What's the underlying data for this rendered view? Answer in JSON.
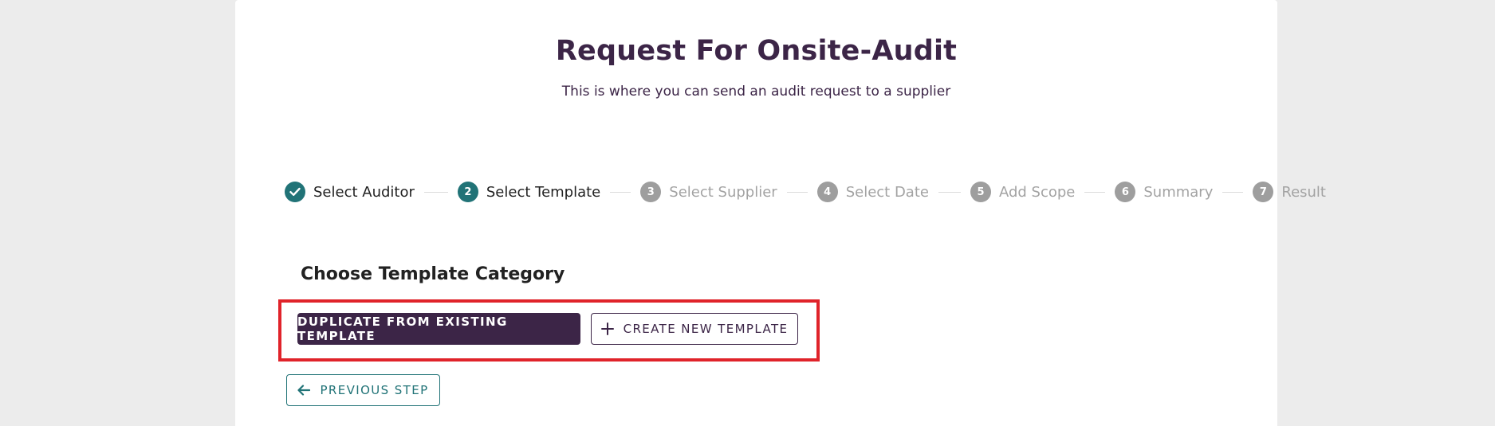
{
  "header": {
    "title": "Request For Onsite-Audit",
    "subtitle": "This is where you can send an audit request to a supplier"
  },
  "stepper": {
    "steps": [
      {
        "number": "1",
        "label": "Select Auditor",
        "state": "done"
      },
      {
        "number": "2",
        "label": "Select Template",
        "state": "active"
      },
      {
        "number": "3",
        "label": "Select Supplier",
        "state": "pending"
      },
      {
        "number": "4",
        "label": "Select Date",
        "state": "pending"
      },
      {
        "number": "5",
        "label": "Add Scope",
        "state": "pending"
      },
      {
        "number": "6",
        "label": "Summary",
        "state": "pending"
      },
      {
        "number": "7",
        "label": "Result",
        "state": "pending"
      }
    ],
    "icons": {
      "done": "check-icon"
    }
  },
  "main": {
    "section_title": "Choose Template Category",
    "duplicate_button": "DUPLICATE FROM EXISTING TEMPLATE",
    "create_button": "CREATE NEW TEMPLATE",
    "create_icon": "plus-icon",
    "previous_button": "PREVIOUS STEP",
    "previous_icon": "arrow-left-icon"
  },
  "colors": {
    "primary": "#3c2547",
    "accent": "#217377",
    "inactive": "#9e9e9e",
    "highlight": "#e0232a",
    "background": "#ececec"
  }
}
